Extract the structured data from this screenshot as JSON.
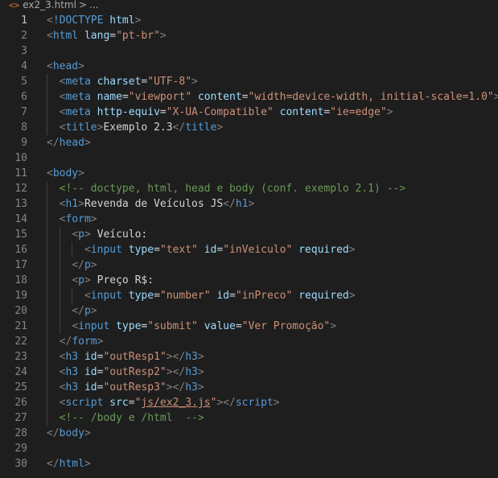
{
  "breadcrumb": {
    "file_icon": "<>",
    "filename": "ex2_3.html",
    "separator": ">",
    "trail": "..."
  },
  "editor": {
    "active_line": 1,
    "lines": [
      {
        "n": "1",
        "indent": 0,
        "tokens": [
          [
            "punc",
            "<"
          ],
          [
            "tag",
            "!DOCTYPE"
          ],
          [
            "text",
            " "
          ],
          [
            "attr",
            "html"
          ],
          [
            "punc",
            ">"
          ]
        ]
      },
      {
        "n": "2",
        "indent": 0,
        "tokens": [
          [
            "punc",
            "<"
          ],
          [
            "tag",
            "html"
          ],
          [
            "text",
            " "
          ],
          [
            "attr",
            "lang"
          ],
          [
            "text",
            "="
          ],
          [
            "str",
            "\"pt-br\""
          ],
          [
            "punc",
            ">"
          ]
        ]
      },
      {
        "n": "3",
        "indent": 0,
        "tokens": []
      },
      {
        "n": "4",
        "indent": 0,
        "tokens": [
          [
            "punc",
            "<"
          ],
          [
            "tag",
            "head"
          ],
          [
            "punc",
            ">"
          ]
        ]
      },
      {
        "n": "5",
        "indent": 1,
        "tokens": [
          [
            "punc",
            "<"
          ],
          [
            "tag",
            "meta"
          ],
          [
            "text",
            " "
          ],
          [
            "attr",
            "charset"
          ],
          [
            "text",
            "="
          ],
          [
            "str",
            "\"UTF-8\""
          ],
          [
            "punc",
            ">"
          ]
        ]
      },
      {
        "n": "6",
        "indent": 1,
        "tokens": [
          [
            "punc",
            "<"
          ],
          [
            "tag",
            "meta"
          ],
          [
            "text",
            " "
          ],
          [
            "attr",
            "name"
          ],
          [
            "text",
            "="
          ],
          [
            "str",
            "\"viewport\""
          ],
          [
            "text",
            " "
          ],
          [
            "attr",
            "content"
          ],
          [
            "text",
            "="
          ],
          [
            "str",
            "\"width=device-width, initial-scale=1.0\""
          ],
          [
            "punc",
            ">"
          ]
        ]
      },
      {
        "n": "7",
        "indent": 1,
        "tokens": [
          [
            "punc",
            "<"
          ],
          [
            "tag",
            "meta"
          ],
          [
            "text",
            " "
          ],
          [
            "attr",
            "http-equiv"
          ],
          [
            "text",
            "="
          ],
          [
            "str",
            "\"X-UA-Compatible\""
          ],
          [
            "text",
            " "
          ],
          [
            "attr",
            "content"
          ],
          [
            "text",
            "="
          ],
          [
            "str",
            "\"ie=edge\""
          ],
          [
            "punc",
            ">"
          ]
        ]
      },
      {
        "n": "8",
        "indent": 1,
        "tokens": [
          [
            "punc",
            "<"
          ],
          [
            "tag",
            "title"
          ],
          [
            "punc",
            ">"
          ],
          [
            "text",
            "Exemplo 2.3"
          ],
          [
            "punc",
            "</"
          ],
          [
            "tag",
            "title"
          ],
          [
            "punc",
            ">"
          ]
        ]
      },
      {
        "n": "9",
        "indent": 0,
        "tokens": [
          [
            "punc",
            "</"
          ],
          [
            "tag",
            "head"
          ],
          [
            "punc",
            ">"
          ]
        ]
      },
      {
        "n": "10",
        "indent": 0,
        "tokens": []
      },
      {
        "n": "11",
        "indent": 0,
        "tokens": [
          [
            "punc",
            "<"
          ],
          [
            "tag",
            "body"
          ],
          [
            "punc",
            ">"
          ]
        ]
      },
      {
        "n": "12",
        "indent": 1,
        "tokens": [
          [
            "comment",
            "<!-- doctype, html, head e body (conf. exemplo 2.1) -->"
          ]
        ]
      },
      {
        "n": "13",
        "indent": 1,
        "tokens": [
          [
            "punc",
            "<"
          ],
          [
            "tag",
            "h1"
          ],
          [
            "punc",
            ">"
          ],
          [
            "text",
            "Revenda de Veículos JS"
          ],
          [
            "punc",
            "</"
          ],
          [
            "tag",
            "h1"
          ],
          [
            "punc",
            ">"
          ]
        ]
      },
      {
        "n": "14",
        "indent": 1,
        "tokens": [
          [
            "punc",
            "<"
          ],
          [
            "tag",
            "form"
          ],
          [
            "punc",
            ">"
          ]
        ]
      },
      {
        "n": "15",
        "indent": 2,
        "tokens": [
          [
            "punc",
            "<"
          ],
          [
            "tag",
            "p"
          ],
          [
            "punc",
            ">"
          ],
          [
            "text",
            " Veículo:"
          ]
        ]
      },
      {
        "n": "16",
        "indent": 3,
        "tokens": [
          [
            "punc",
            "<"
          ],
          [
            "tag",
            "input"
          ],
          [
            "text",
            " "
          ],
          [
            "attr",
            "type"
          ],
          [
            "text",
            "="
          ],
          [
            "str",
            "\"text\""
          ],
          [
            "text",
            " "
          ],
          [
            "attr",
            "id"
          ],
          [
            "text",
            "="
          ],
          [
            "str",
            "\"inVeiculo\""
          ],
          [
            "text",
            " "
          ],
          [
            "attr",
            "required"
          ],
          [
            "punc",
            ">"
          ]
        ]
      },
      {
        "n": "17",
        "indent": 2,
        "tokens": [
          [
            "punc",
            "</"
          ],
          [
            "tag",
            "p"
          ],
          [
            "punc",
            ">"
          ]
        ]
      },
      {
        "n": "18",
        "indent": 2,
        "tokens": [
          [
            "punc",
            "<"
          ],
          [
            "tag",
            "p"
          ],
          [
            "punc",
            ">"
          ],
          [
            "text",
            " Preço R$:"
          ]
        ]
      },
      {
        "n": "19",
        "indent": 3,
        "tokens": [
          [
            "punc",
            "<"
          ],
          [
            "tag",
            "input"
          ],
          [
            "text",
            " "
          ],
          [
            "attr",
            "type"
          ],
          [
            "text",
            "="
          ],
          [
            "str",
            "\"number\""
          ],
          [
            "text",
            " "
          ],
          [
            "attr",
            "id"
          ],
          [
            "text",
            "="
          ],
          [
            "str",
            "\"inPreco\""
          ],
          [
            "text",
            " "
          ],
          [
            "attr",
            "required"
          ],
          [
            "punc",
            ">"
          ]
        ]
      },
      {
        "n": "20",
        "indent": 2,
        "tokens": [
          [
            "punc",
            "</"
          ],
          [
            "tag",
            "p"
          ],
          [
            "punc",
            ">"
          ]
        ]
      },
      {
        "n": "21",
        "indent": 2,
        "tokens": [
          [
            "punc",
            "<"
          ],
          [
            "tag",
            "input"
          ],
          [
            "text",
            " "
          ],
          [
            "attr",
            "type"
          ],
          [
            "text",
            "="
          ],
          [
            "str",
            "\"submit\""
          ],
          [
            "text",
            " "
          ],
          [
            "attr",
            "value"
          ],
          [
            "text",
            "="
          ],
          [
            "str",
            "\"Ver Promoção\""
          ],
          [
            "punc",
            ">"
          ]
        ]
      },
      {
        "n": "22",
        "indent": 1,
        "tokens": [
          [
            "punc",
            "</"
          ],
          [
            "tag",
            "form"
          ],
          [
            "punc",
            ">"
          ]
        ]
      },
      {
        "n": "23",
        "indent": 1,
        "tokens": [
          [
            "punc",
            "<"
          ],
          [
            "tag",
            "h3"
          ],
          [
            "text",
            " "
          ],
          [
            "attr",
            "id"
          ],
          [
            "text",
            "="
          ],
          [
            "str",
            "\"outResp1\""
          ],
          [
            "punc",
            ">"
          ],
          [
            "punc",
            "</"
          ],
          [
            "tag",
            "h3"
          ],
          [
            "punc",
            ">"
          ]
        ]
      },
      {
        "n": "24",
        "indent": 1,
        "tokens": [
          [
            "punc",
            "<"
          ],
          [
            "tag",
            "h3"
          ],
          [
            "text",
            " "
          ],
          [
            "attr",
            "id"
          ],
          [
            "text",
            "="
          ],
          [
            "str",
            "\"outResp2\""
          ],
          [
            "punc",
            ">"
          ],
          [
            "punc",
            "</"
          ],
          [
            "tag",
            "h3"
          ],
          [
            "punc",
            ">"
          ]
        ]
      },
      {
        "n": "25",
        "indent": 1,
        "tokens": [
          [
            "punc",
            "<"
          ],
          [
            "tag",
            "h3"
          ],
          [
            "text",
            " "
          ],
          [
            "attr",
            "id"
          ],
          [
            "text",
            "="
          ],
          [
            "str",
            "\"outResp3\""
          ],
          [
            "punc",
            ">"
          ],
          [
            "punc",
            "</"
          ],
          [
            "tag",
            "h3"
          ],
          [
            "punc",
            ">"
          ]
        ]
      },
      {
        "n": "26",
        "indent": 1,
        "tokens": [
          [
            "punc",
            "<"
          ],
          [
            "tag",
            "script"
          ],
          [
            "text",
            " "
          ],
          [
            "attr",
            "src"
          ],
          [
            "text",
            "="
          ],
          [
            "str",
            "\""
          ],
          [
            "strlink",
            "js/ex2_3.js"
          ],
          [
            "str",
            "\""
          ],
          [
            "punc",
            ">"
          ],
          [
            "punc",
            "</"
          ],
          [
            "tag",
            "script"
          ],
          [
            "punc",
            ">"
          ]
        ]
      },
      {
        "n": "27",
        "indent": 1,
        "tokens": [
          [
            "comment",
            "<!-- /body e /html  -->"
          ]
        ]
      },
      {
        "n": "28",
        "indent": 0,
        "tokens": [
          [
            "punc",
            "</"
          ],
          [
            "tag",
            "body"
          ],
          [
            "punc",
            ">"
          ]
        ]
      },
      {
        "n": "29",
        "indent": 0,
        "tokens": []
      },
      {
        "n": "30",
        "indent": 0,
        "tokens": [
          [
            "punc",
            "</"
          ],
          [
            "tag",
            "html"
          ],
          [
            "punc",
            ">"
          ]
        ]
      }
    ]
  }
}
